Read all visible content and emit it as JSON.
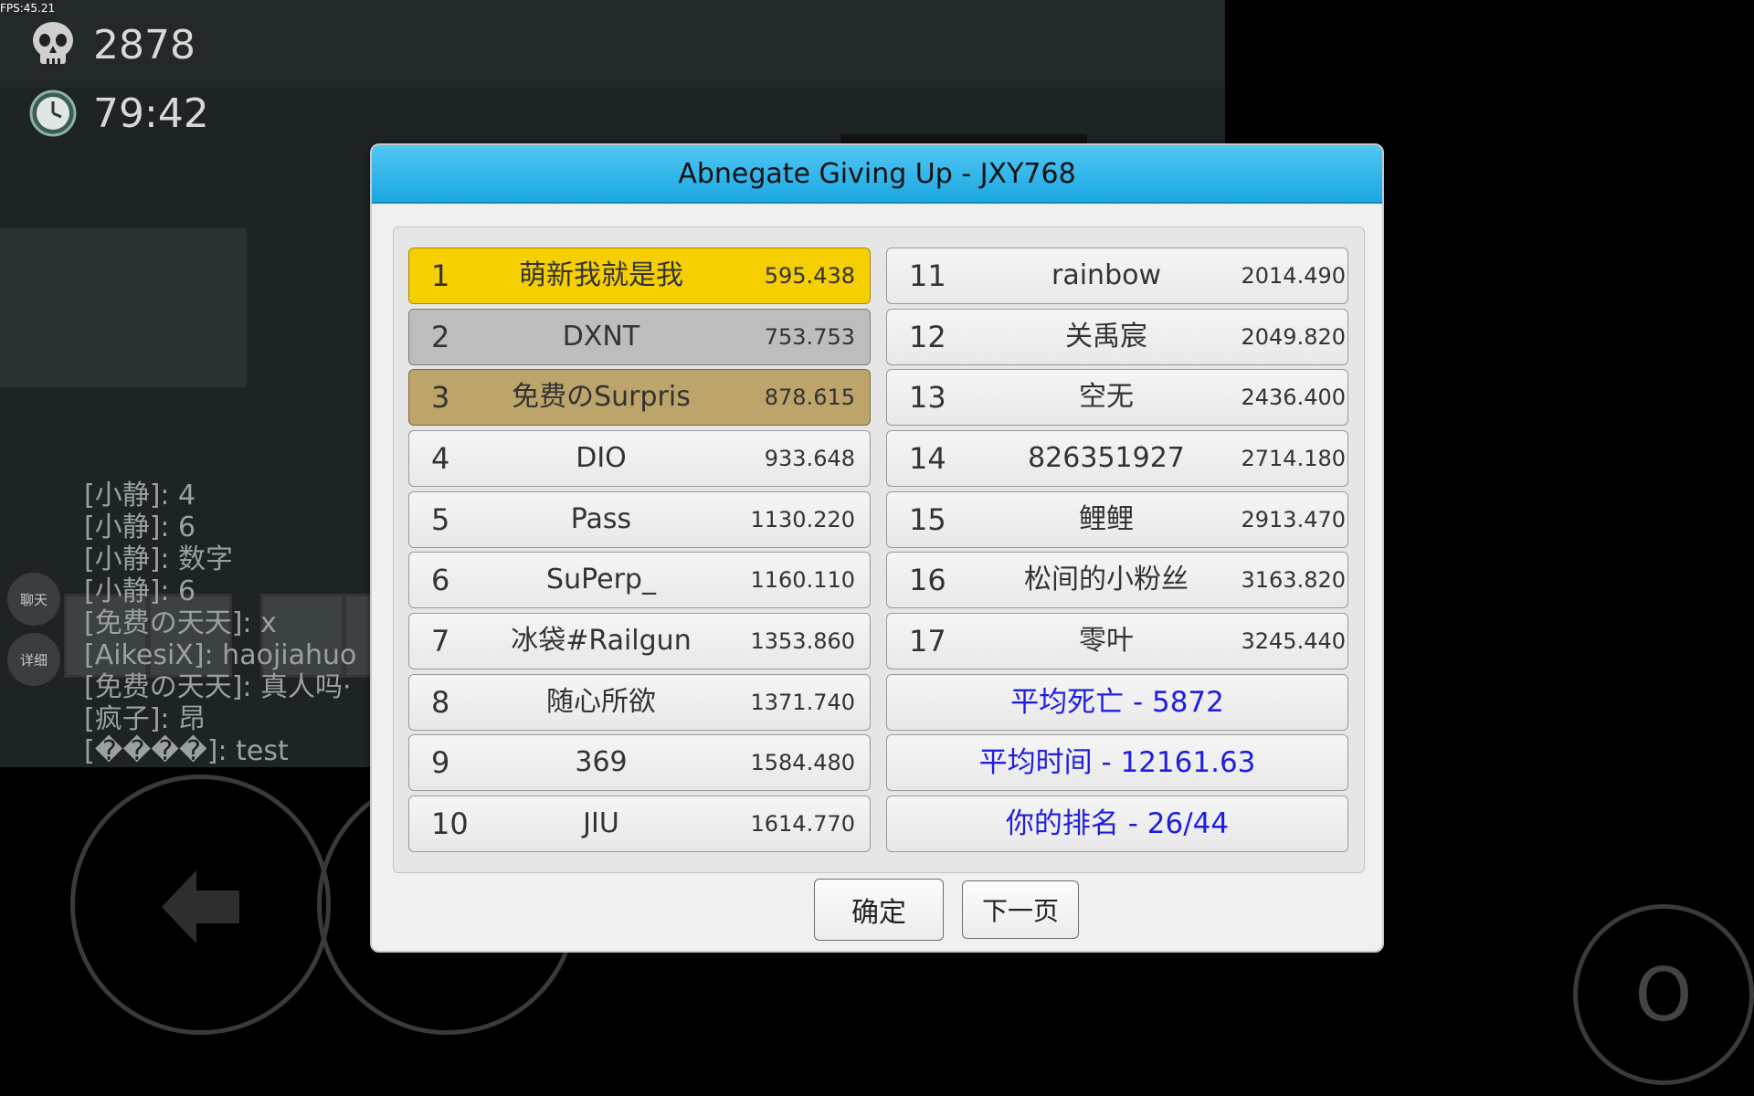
{
  "fps": "FPS:45.21",
  "hud": {
    "deaths": "2878",
    "timer": "79:42"
  },
  "chat": {
    "lines": [
      "[小静]: 4",
      "[小静]: 6",
      "[小静]: 数字",
      "[小静]: 6",
      "[免费の天天]: x",
      "[AikesiX]: haojiahuo",
      "[免费の天天]: 真人吗·",
      "[疯子]: 昂",
      "[����]: test"
    ],
    "chat_button": "聊天",
    "detail_button": "详细"
  },
  "controls": {
    "jump_label": "O"
  },
  "dialog": {
    "title": "Abnegate Giving Up - JXY768",
    "left": [
      {
        "rank": "1",
        "name": "萌新我就是我",
        "score": "595.438"
      },
      {
        "rank": "2",
        "name": "DXNT",
        "score": "753.753"
      },
      {
        "rank": "3",
        "name": "免费のSurpris",
        "score": "878.615"
      },
      {
        "rank": "4",
        "name": "DIO",
        "score": "933.648"
      },
      {
        "rank": "5",
        "name": "Pass",
        "score": "1130.220"
      },
      {
        "rank": "6",
        "name": "SuPerp_",
        "score": "1160.110"
      },
      {
        "rank": "7",
        "name": "冰袋#Railgun",
        "score": "1353.860"
      },
      {
        "rank": "8",
        "name": "随心所欲",
        "score": "1371.740"
      },
      {
        "rank": "9",
        "name": "369",
        "score": "1584.480"
      },
      {
        "rank": "10",
        "name": "JIU",
        "score": "1614.770"
      }
    ],
    "right": [
      {
        "rank": "11",
        "name": "rainbow",
        "score": "2014.490"
      },
      {
        "rank": "12",
        "name": "关禹宸",
        "score": "2049.820"
      },
      {
        "rank": "13",
        "name": "空无",
        "score": "2436.400"
      },
      {
        "rank": "14",
        "name": "826351927",
        "score": "2714.180"
      },
      {
        "rank": "15",
        "name": "鲤鲤",
        "score": "2913.470"
      },
      {
        "rank": "16",
        "name": "松间的小粉丝",
        "score": "3163.820"
      },
      {
        "rank": "17",
        "name": "零叶",
        "score": "3245.440"
      }
    ],
    "stats": {
      "avg_deaths": "平均死亡 - 5872",
      "avg_time": "平均时间 - 12161.63",
      "your_rank": "你的排名 - 26/44"
    },
    "ok_button": "确定",
    "next_button": "下一页"
  }
}
